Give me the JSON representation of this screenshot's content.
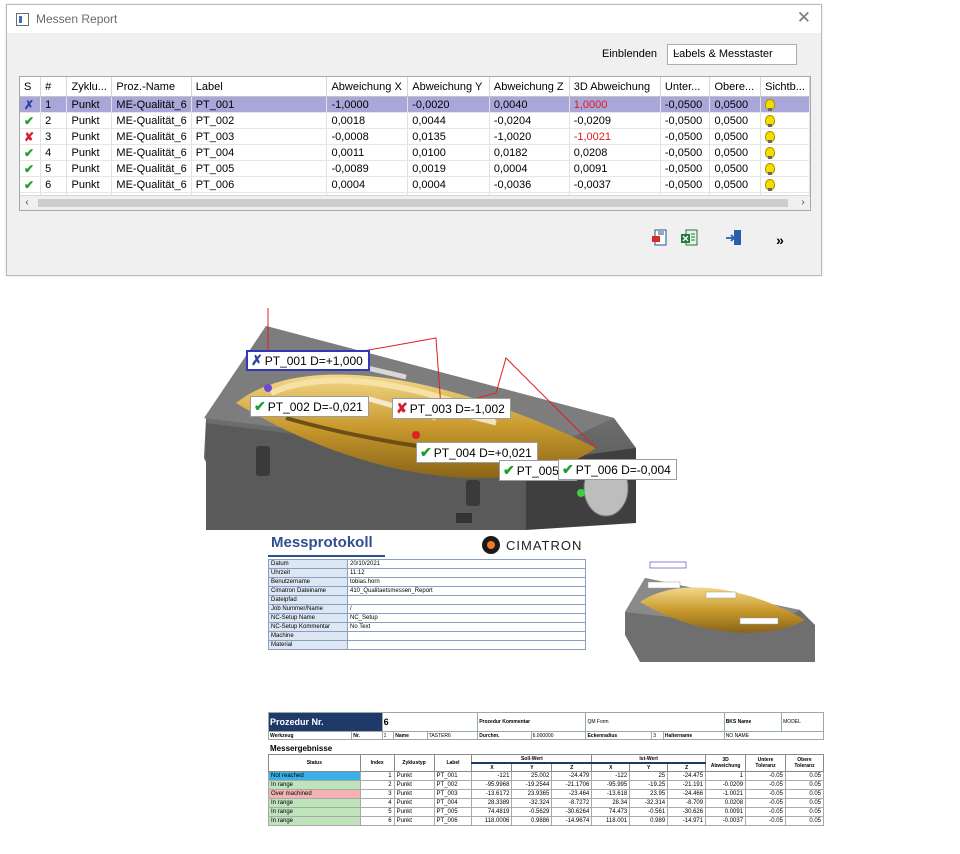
{
  "window": {
    "title": "Messen Report",
    "filter_label": "Einblenden",
    "filter_value": "Labels & Messtaster",
    "columns": [
      "S",
      "#",
      "Zyklu...",
      "Proz.-Name",
      "Label",
      "Abweichung X",
      "Abweichung Y",
      "Abweichung Z",
      "3D Abweichung",
      "Unter...",
      "Obere...",
      "Sichtb..."
    ],
    "rows": [
      {
        "status": "selected",
        "num": "1",
        "zyklus": "Punkt",
        "proz": "ME-Qualität_6",
        "label": "PT_001",
        "dx": "-1,0000",
        "dy": "-0,0020",
        "dz": "0,0040",
        "d3": "1,0000",
        "unter": "-0,0500",
        "obere": "0,0500",
        "d3_red": true
      },
      {
        "status": "ok",
        "num": "2",
        "zyklus": "Punkt",
        "proz": "ME-Qualität_6",
        "label": "PT_002",
        "dx": "0,0018",
        "dy": "0,0044",
        "dz": "-0,0204",
        "d3": "-0,0209",
        "unter": "-0,0500",
        "obere": "0,0500",
        "d3_red": false
      },
      {
        "status": "bad",
        "num": "3",
        "zyklus": "Punkt",
        "proz": "ME-Qualität_6",
        "label": "PT_003",
        "dx": "-0,0008",
        "dy": "0,0135",
        "dz": "-1,0020",
        "d3": "-1,0021",
        "unter": "-0,0500",
        "obere": "0,0500",
        "d3_red": true
      },
      {
        "status": "ok",
        "num": "4",
        "zyklus": "Punkt",
        "proz": "ME-Qualität_6",
        "label": "PT_004",
        "dx": "0,0011",
        "dy": "0,0100",
        "dz": "0,0182",
        "d3": "0,0208",
        "unter": "-0,0500",
        "obere": "0,0500",
        "d3_red": false
      },
      {
        "status": "ok",
        "num": "5",
        "zyklus": "Punkt",
        "proz": "ME-Qualität_6",
        "label": "PT_005",
        "dx": "-0,0089",
        "dy": "0,0019",
        "dz": "0,0004",
        "d3": "0,0091",
        "unter": "-0,0500",
        "obere": "0,0500",
        "d3_red": false
      },
      {
        "status": "ok",
        "num": "6",
        "zyklus": "Punkt",
        "proz": "ME-Qualität_6",
        "label": "PT_006",
        "dx": "0,0004",
        "dy": "0,0004",
        "dz": "-0,0036",
        "d3": "-0,0037",
        "unter": "-0,0500",
        "obere": "0,0500",
        "d3_red": false
      }
    ],
    "toolbar_icons": [
      "export-pdf-icon",
      "export-excel-icon",
      "exit-icon",
      "more-icon"
    ],
    "more_label": "»"
  },
  "view3d_labels": [
    {
      "status": "selected",
      "text": "PT_001 D=+1,000"
    },
    {
      "status": "ok",
      "text": "PT_002 D=-0,021"
    },
    {
      "status": "bad",
      "text": "PT_003 D=-1,002"
    },
    {
      "status": "ok",
      "text": "PT_004 D=+0,021"
    },
    {
      "status": "ok",
      "text": "PT_005 D"
    },
    {
      "status": "ok",
      "text": "PT_006 D=-0,004"
    }
  ],
  "report": {
    "title": "Messprotokoll",
    "brand": "CIMATRON",
    "info": [
      {
        "k": "Datum",
        "v": "20/10/2021"
      },
      {
        "k": "Uhrzeit",
        "v": "11:12"
      },
      {
        "k": "Benutzername",
        "v": "tobias.horn"
      },
      {
        "k": "Cimatron Dateiname",
        "v": "410_Qualitaetsmessen_Report"
      },
      {
        "k": "Dateipfad",
        "v": ""
      },
      {
        "k": "Job Nummer/Name",
        "v": "/"
      },
      {
        "k": "NC-Setup Name",
        "v": "NC_Setup"
      },
      {
        "k": "NC-Setup Kommentar",
        "v": "No Text"
      },
      {
        "k": "Machine",
        "v": ""
      },
      {
        "k": "Material",
        "v": ""
      }
    ],
    "prozedur_label": "Prozedur Nr.",
    "prozedur_nr": "6",
    "prozedur_kommentar_label": "Prozedur Kommentar",
    "prozedur_kommentar": "QM Form",
    "bks_label": "BKS Name",
    "bks_value": "MODEL",
    "werkzeug_label": "Werkzeug",
    "nr_label": "Nr.",
    "nr_value": "1",
    "name_label": "Name",
    "name_value": "TASTER6",
    "durchm_label": "Durchm.",
    "durchm_value": "6.000000",
    "eckenradius_label": "Eckenradius",
    "eckenradius_value": "3",
    "halter_label": "Haltername",
    "halter_value": "NO NAME",
    "messergebnisse": "Messergebnisse",
    "headers": {
      "status": "Status",
      "index": "Index",
      "zyklus": "Zyklustyp",
      "label": "Label",
      "soll": "Soll-Wert",
      "ist": "Ist-Wert",
      "abw": "3D Abweichung",
      "unt": "Untere Toleranz",
      "ob": "Obere Toleranz",
      "x": "X",
      "y": "Y",
      "z": "Z"
    },
    "rows": [
      {
        "status": "Not reached",
        "cls": "nr",
        "index": "1",
        "zyklus": "Punkt",
        "label": "PT_001",
        "sx": "-121",
        "sy": "25.002",
        "sz": "-24.479",
        "ix": "-122",
        "iy": "25",
        "iz": "-24.475",
        "abw": "1",
        "unt": "-0.05",
        "ob": "0.05"
      },
      {
        "status": "In range",
        "cls": "ir",
        "index": "2",
        "zyklus": "Punkt",
        "label": "PT_002",
        "sx": "-95.9968",
        "sy": "-19.2544",
        "sz": "-21.1706",
        "ix": "-95.995",
        "iy": "-19.25",
        "iz": "-21.191",
        "abw": "-0.0209",
        "unt": "-0.05",
        "ob": "0.05"
      },
      {
        "status": "Over machined",
        "cls": "om",
        "index": "3",
        "zyklus": "Punkt",
        "label": "PT_003",
        "sx": "-13.6172",
        "sy": "23.9365",
        "sz": "-23.464",
        "ix": "-13.618",
        "iy": "23.95",
        "iz": "-24.466",
        "abw": "-1.0021",
        "unt": "-0.05",
        "ob": "0.05"
      },
      {
        "status": "In range",
        "cls": "ir",
        "index": "4",
        "zyklus": "Punkt",
        "label": "PT_004",
        "sx": "28.3389",
        "sy": "-32.324",
        "sz": "-8.7272",
        "ix": "28.34",
        "iy": "-32.314",
        "iz": "-8.709",
        "abw": "0.0208",
        "unt": "-0.05",
        "ob": "0.05"
      },
      {
        "status": "In range",
        "cls": "ir",
        "index": "5",
        "zyklus": "Punkt",
        "label": "PT_005",
        "sx": "74.4819",
        "sy": "-0.5629",
        "sz": "-30.6264",
        "ix": "74.473",
        "iy": "-0.561",
        "iz": "-30.626",
        "abw": "0.0091",
        "unt": "-0.05",
        "ob": "0.05"
      },
      {
        "status": "In range",
        "cls": "ir",
        "index": "6",
        "zyklus": "Punkt",
        "label": "PT_006",
        "sx": "118.0006",
        "sy": "0.9886",
        "sz": "-14.9674",
        "ix": "118.001",
        "iy": "0.989",
        "iz": "-14.971",
        "abw": "-0.0037",
        "unt": "-0.05",
        "ob": "0.05"
      }
    ]
  },
  "colors": {
    "selected_row": "#a9a6d9",
    "ok": "#1f9e2c",
    "bad": "#d2232a",
    "report_header": "#1f3a68",
    "not_reached": "#3bb0e4",
    "in_range": "#bfe4bc",
    "over_machined": "#f5b3b3"
  }
}
